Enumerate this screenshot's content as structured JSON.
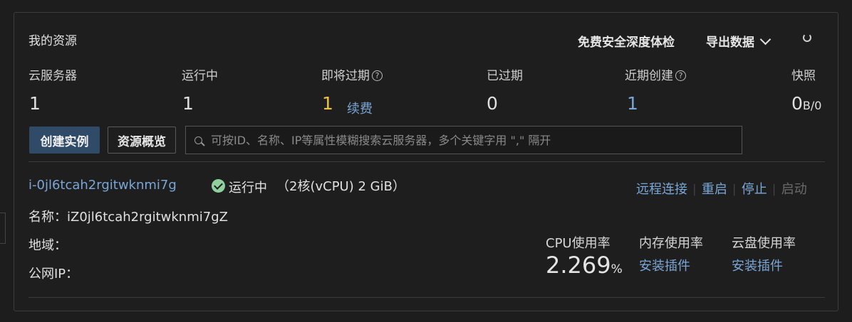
{
  "header": {
    "title": "我的资源",
    "security_check": "免费安全深度体检",
    "export": "导出数据"
  },
  "stats": [
    {
      "label": "云服务器",
      "value": "1"
    },
    {
      "label": "运行中",
      "value": "1"
    },
    {
      "label": "即将过期",
      "value": "1",
      "link": "续费"
    },
    {
      "label": "已过期",
      "value": "0"
    },
    {
      "label": "近期创建",
      "value": "1"
    },
    {
      "label": "快照",
      "value": "0",
      "unit": "B/0"
    }
  ],
  "toolbar": {
    "create_label": "创建实例",
    "overview_label": "资源概览",
    "search_placeholder": "可按ID、名称、IP等属性模糊搜索云服务器，多个关键字用 \",\" 隔开"
  },
  "instance": {
    "id": "i-0jl6tcah2rgitwknmi7g",
    "status": "运行中",
    "spec": "（2核(vCPU) 2 GiB）",
    "name_label": "名称：",
    "name_value": "iZ0jl6tcah2rgitwknmi7gZ",
    "region_label": "地域：",
    "ip_label": "公网IP：",
    "actions": {
      "remote": "远程连接",
      "restart": "重启",
      "stop": "停止",
      "start": "启动"
    },
    "metrics": {
      "cpu_label": "CPU使用率",
      "cpu_value": "2.269",
      "cpu_unit": "%",
      "mem_label": "内存使用率",
      "mem_link": "安装插件",
      "disk_label": "云盘使用率",
      "disk_link": "安装插件"
    }
  }
}
